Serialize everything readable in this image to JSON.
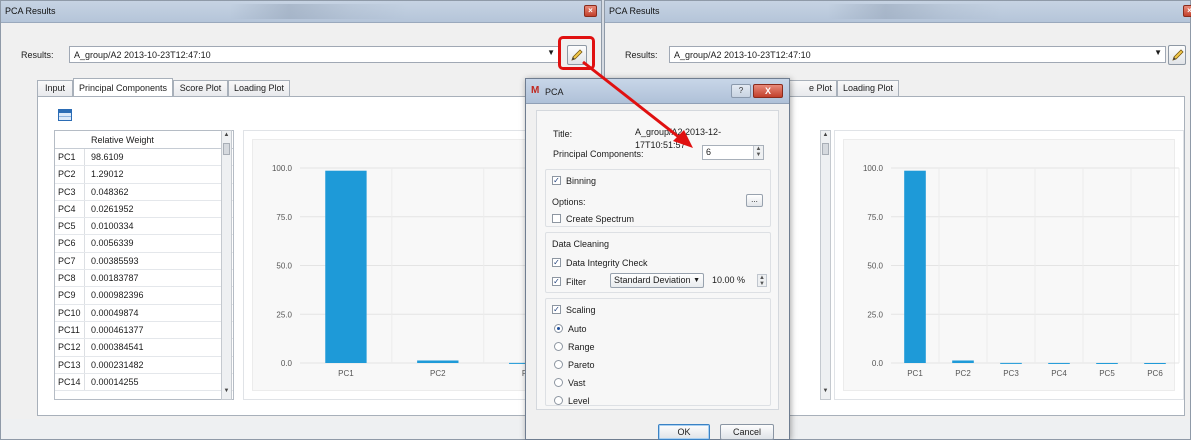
{
  "left_window": {
    "title": "PCA Results",
    "results_label": "Results:",
    "results_value": "A_group/A2 2013-10-23T12:47:10",
    "tabs": [
      "Input",
      "Principal Components",
      "Score Plot",
      "Loading Plot"
    ],
    "active_tab": "Principal Components",
    "table_header": "Relative Weight",
    "rows": [
      {
        "pc": "PC1",
        "weight": "98.6109"
      },
      {
        "pc": "PC2",
        "weight": "1.29012"
      },
      {
        "pc": "PC3",
        "weight": "0.048362"
      },
      {
        "pc": "PC4",
        "weight": "0.0261952"
      },
      {
        "pc": "PC5",
        "weight": "0.0100334"
      },
      {
        "pc": "PC6",
        "weight": "0.0056339"
      },
      {
        "pc": "PC7",
        "weight": "0.00385593"
      },
      {
        "pc": "PC8",
        "weight": "0.00183787"
      },
      {
        "pc": "PC9",
        "weight": "0.000982396"
      },
      {
        "pc": "PC10",
        "weight": "0.00049874"
      },
      {
        "pc": "PC11",
        "weight": "0.000461377"
      },
      {
        "pc": "PC12",
        "weight": "0.000384541"
      },
      {
        "pc": "PC13",
        "weight": "0.000231482"
      },
      {
        "pc": "PC14",
        "weight": "0.00014255"
      }
    ]
  },
  "right_window": {
    "title": "PCA Results",
    "results_label": "Results:",
    "results_value": "A_group/A2 2013-10-23T12:47:10",
    "tabs_visible": [
      "Score Plot",
      "Loading Plot"
    ],
    "score_plot_tab_partial": "e Plot"
  },
  "left_chart": {
    "type": "bar",
    "categories": [
      "PC1",
      "PC2",
      "PC3"
    ],
    "values": [
      98.6109,
      1.29012,
      0.048362
    ],
    "yticks": [
      "100.0",
      "75.0",
      "50.0",
      "25.0",
      "0.0"
    ],
    "ylim": [
      0,
      100
    ],
    "color": "#1e9ad8"
  },
  "right_chart": {
    "type": "bar",
    "categories": [
      "PC1",
      "PC2",
      "PC3",
      "PC4",
      "PC5",
      "PC6"
    ],
    "values": [
      98.6109,
      1.29012,
      0.048362,
      0.0261952,
      0.0100334,
      0.0056339
    ],
    "yticks": [
      "100.0",
      "75.0",
      "50.0",
      "25.0",
      "0.0"
    ],
    "ylim": [
      0,
      100
    ],
    "color": "#1e9ad8"
  },
  "dialog": {
    "title": "PCA",
    "help_label": "?",
    "close_label": "X",
    "title_label": "Title:",
    "title_value": "A_group/A2 2013-12-17T10:51:57",
    "pc_label": "Principal Components:",
    "pc_value": "6",
    "binning_label": "Binning",
    "binning_checked": true,
    "options_label": "Options:",
    "options_button": "...",
    "create_spectrum_label": "Create Spectrum",
    "create_spectrum_checked": false,
    "data_cleaning_label": "Data Cleaning",
    "integrity_label": "Data Integrity Check",
    "integrity_checked": true,
    "filter_label": "Filter",
    "filter_checked": true,
    "filter_method": "Standard Deviation",
    "filter_value": "10.00 %",
    "scaling_label": "Scaling",
    "scaling_checked": true,
    "scaling_options": [
      "Auto",
      "Range",
      "Pareto",
      "Vast",
      "Level"
    ],
    "scaling_selected": "Auto",
    "ok_label": "OK",
    "cancel_label": "Cancel"
  },
  "colors": {
    "annotation_red": "#e01010",
    "bar_blue": "#1e9ad8"
  }
}
